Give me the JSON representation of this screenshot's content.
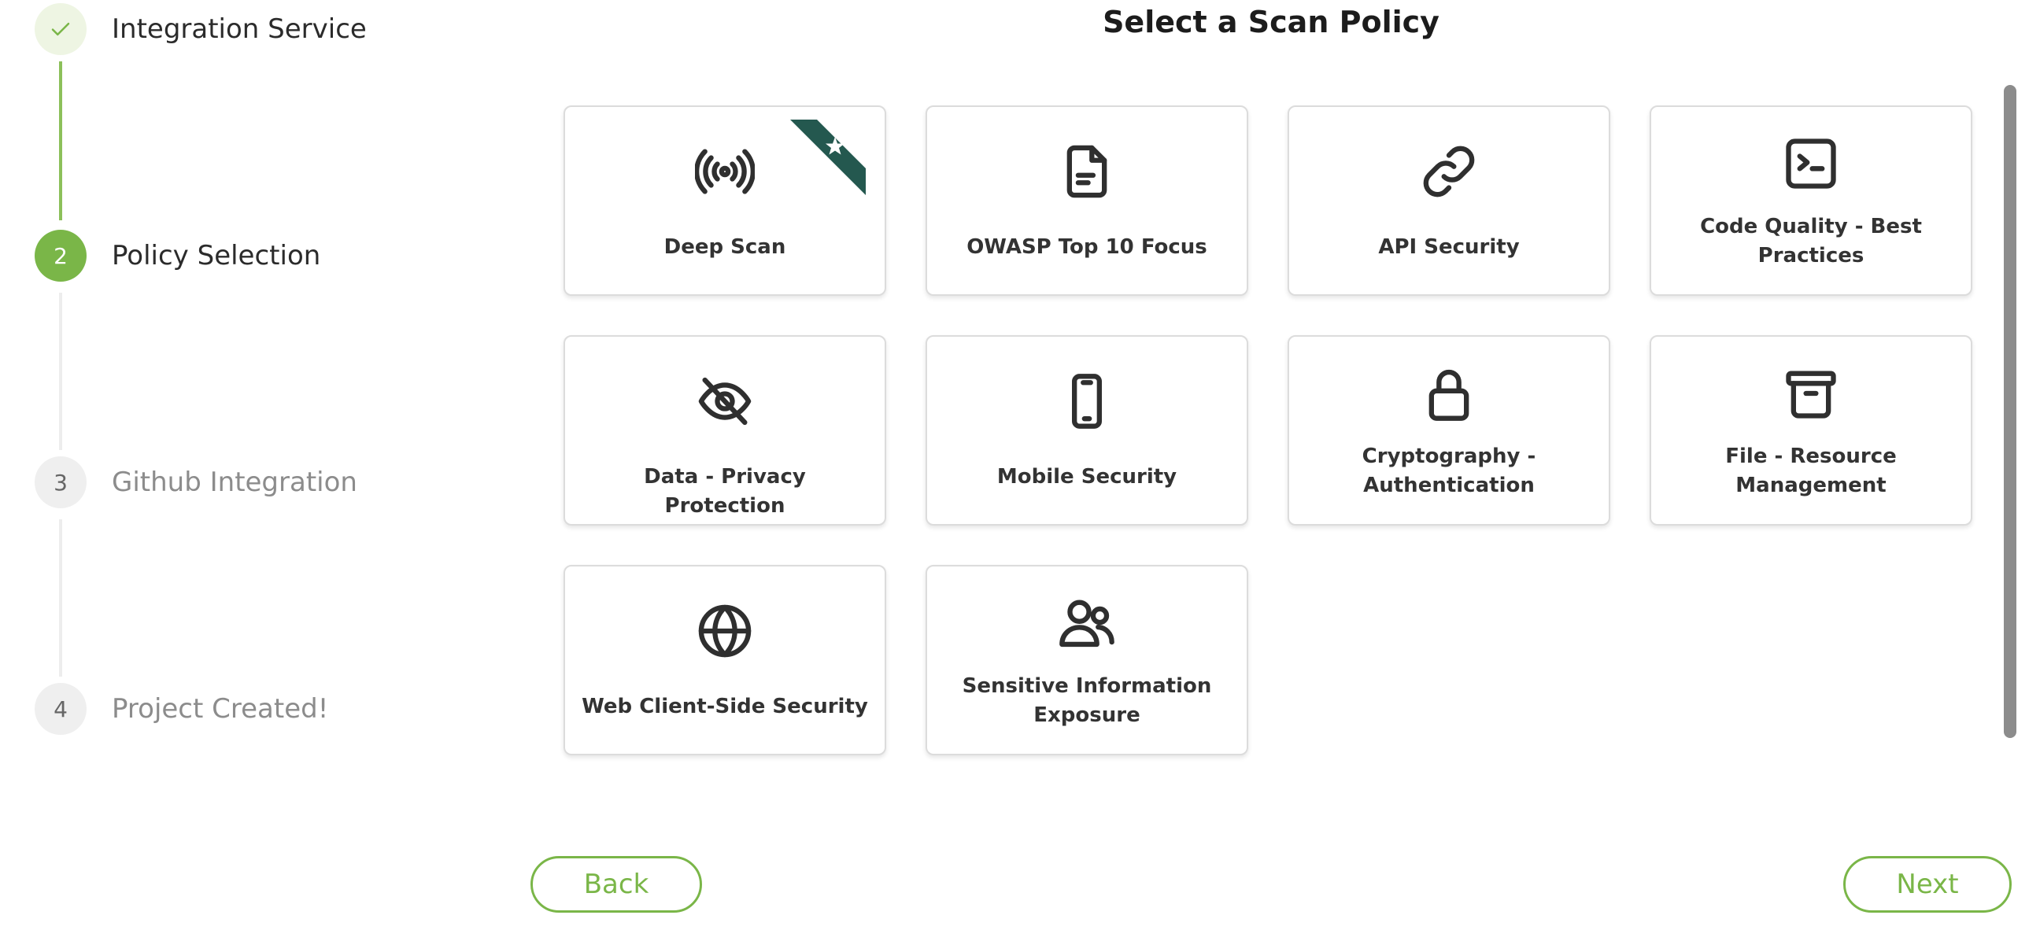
{
  "stepper": {
    "steps": [
      {
        "number": "✓",
        "label": "Integration Service",
        "state": "done"
      },
      {
        "number": "2",
        "label": "Policy Selection",
        "state": "active"
      },
      {
        "number": "3",
        "label": "Github Integration",
        "state": "pending"
      },
      {
        "number": "4",
        "label": "Project Created!",
        "state": "pending"
      }
    ]
  },
  "main": {
    "title": "Select a Scan Policy",
    "policies": [
      {
        "label": "Deep Scan",
        "icon": "broadcast-icon",
        "featured": true
      },
      {
        "label": "OWASP Top 10 Focus",
        "icon": "document-icon"
      },
      {
        "label": "API Security",
        "icon": "link-icon"
      },
      {
        "label": "Code Quality - Best Practices",
        "icon": "terminal-icon"
      },
      {
        "label": "Data - Privacy Protection",
        "icon": "eye-off-icon"
      },
      {
        "label": "Mobile Security",
        "icon": "mobile-phone-icon"
      },
      {
        "label": "Cryptography - Authentication",
        "icon": "lock-icon"
      },
      {
        "label": "File - Resource Management",
        "icon": "archive-box-icon"
      },
      {
        "label": "Web Client-Side Security",
        "icon": "globe-icon"
      },
      {
        "label": "Sensitive Information Exposure",
        "icon": "users-icon"
      }
    ]
  },
  "footer": {
    "back_label": "Back",
    "next_label": "Next"
  },
  "colors": {
    "accent": "#7ab648",
    "ribbon": "#24584f"
  }
}
